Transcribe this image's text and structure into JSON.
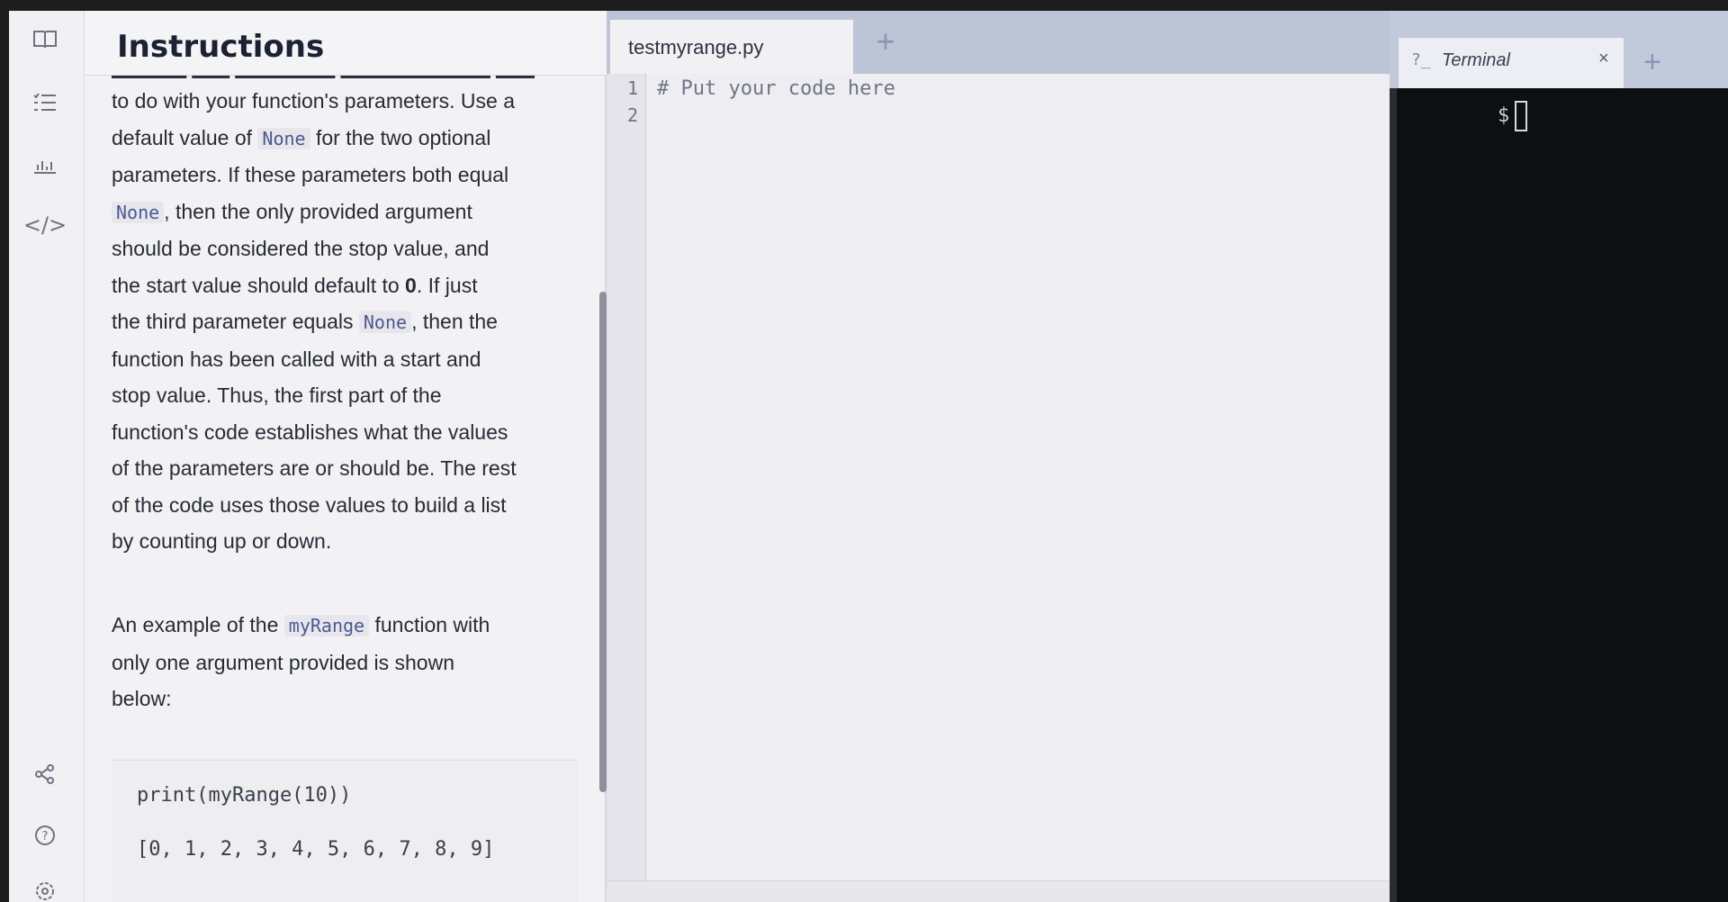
{
  "rail": {
    "icons": [
      "book-icon",
      "list-icon",
      "chart-icon",
      "code-icon",
      "share-icon",
      "help-icon",
      "settings-icon"
    ],
    "code_glyph": "</>"
  },
  "instructions": {
    "title": "Instructions",
    "lines": [
      [
        "to do with your function's parameters. Use a"
      ],
      [
        "default value of ",
        {
          "code": "None"
        },
        " for the two optional"
      ],
      [
        "parameters. If these parameters both equal"
      ],
      [
        {
          "code": "None"
        },
        ", then the only provided argument"
      ],
      [
        "should be considered the stop value, and"
      ],
      [
        "the start value should default to ",
        {
          "bold": "0"
        },
        ". If just"
      ],
      [
        "the third parameter equals ",
        {
          "code": "None"
        },
        ", then the"
      ],
      [
        "function has been called with a start and"
      ],
      [
        "stop value. Thus, the first part of the"
      ],
      [
        "function's code establishes what the values"
      ],
      [
        "of the parameters are or should be. The rest"
      ],
      [
        "of the code uses those values to build a list"
      ],
      [
        "by counting up or down."
      ]
    ],
    "example_lines": [
      [
        "An example of the ",
        {
          "code": "myRange"
        },
        " function with"
      ],
      [
        "only one argument provided is shown"
      ],
      [
        "below:"
      ]
    ],
    "code_block": {
      "call": "print(myRange(10))",
      "output": "[0, 1, 2, 3, 4, 5, 6, 7, 8, 9]"
    }
  },
  "editor": {
    "tab_label": "testmyrange.py",
    "add_tab": "+",
    "lines": [
      {
        "number": "1",
        "text": "# Put your code here"
      },
      {
        "number": "2",
        "text": ""
      }
    ]
  },
  "terminal": {
    "tab_label": "Terminal",
    "prompt_icon": "?_",
    "close": "×",
    "add_tab": "+",
    "prompt": "$"
  }
}
